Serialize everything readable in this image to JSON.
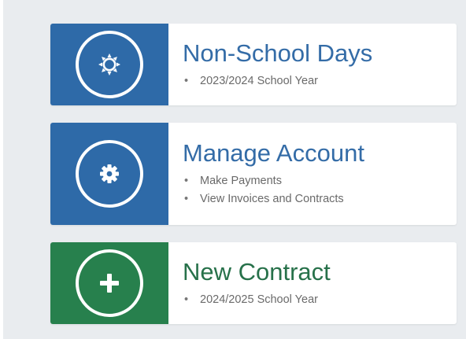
{
  "colors": {
    "blue_tile": "#2e6aa8",
    "green_tile": "#27804d",
    "blue_text": "#346ca7",
    "green_text": "#27714a",
    "background": "#e9ecef"
  },
  "cards": [
    {
      "icon": "sun-icon",
      "title": "Non-School Days",
      "items": [
        "2023/2024 School Year"
      ]
    },
    {
      "icon": "gear-icon",
      "title": "Manage Account",
      "items": [
        "Make Payments",
        "View Invoices and Contracts"
      ]
    },
    {
      "icon": "plus-icon",
      "title": "New Contract",
      "items": [
        "2024/2025 School Year"
      ]
    }
  ]
}
